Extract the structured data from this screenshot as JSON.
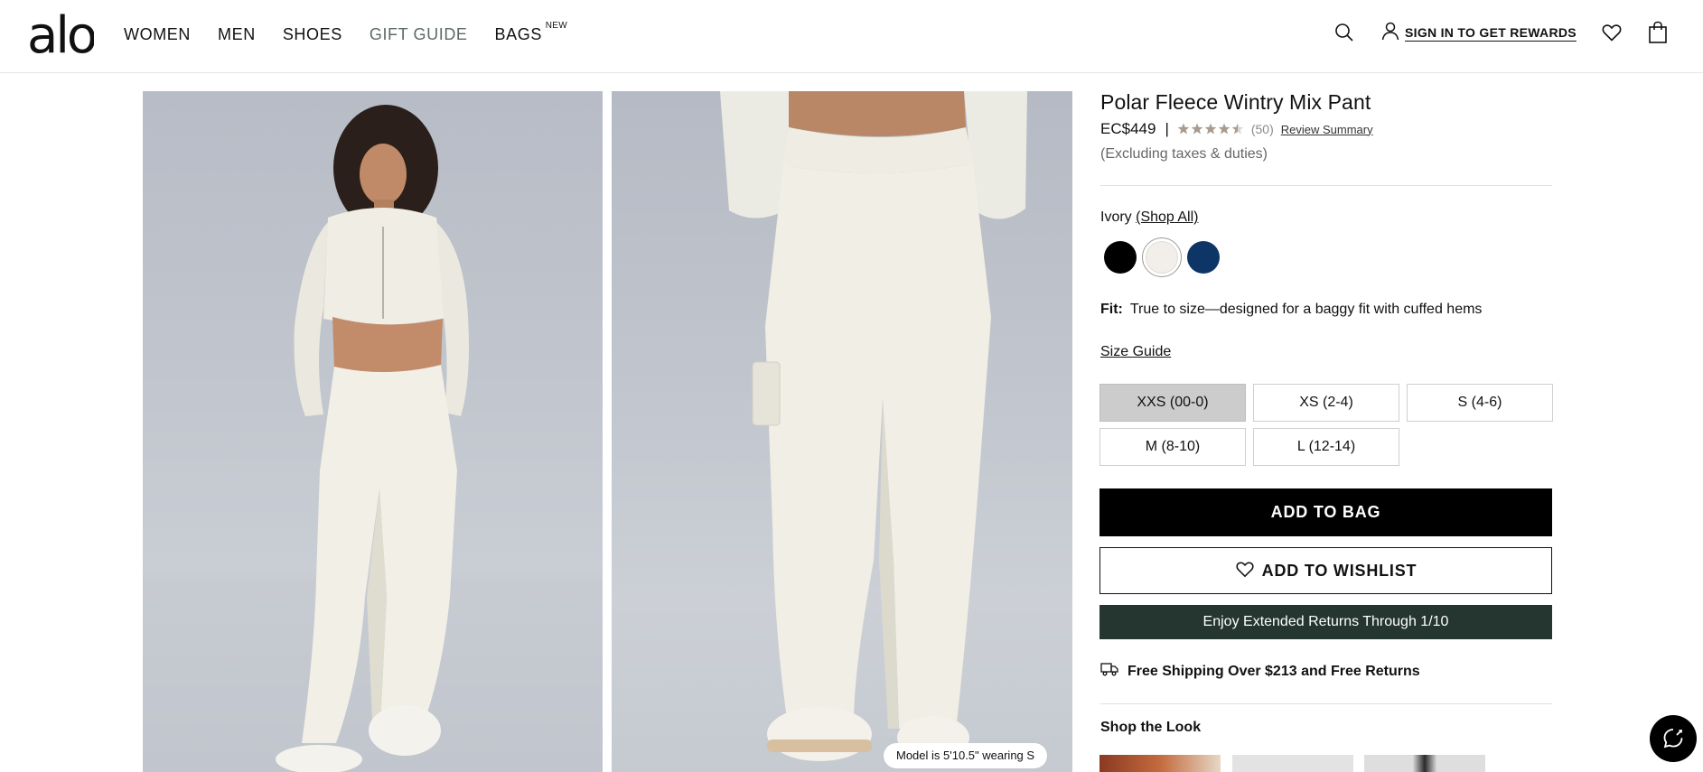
{
  "header": {
    "logo_text": "alo",
    "nav": [
      {
        "label": "WOMEN"
      },
      {
        "label": "MEN"
      },
      {
        "label": "SHOES"
      },
      {
        "label": "GIFT GUIDE"
      },
      {
        "label": "BAGS",
        "badge": "NEW"
      }
    ],
    "signin_label": "SIGN IN TO GET REWARDS",
    "icons": [
      "search-icon",
      "user-icon",
      "heart-icon",
      "shopping-bag-icon"
    ]
  },
  "gallery": {
    "model_info": "Model is 5'10.5\" wearing S"
  },
  "product": {
    "title": "Polar Fleece Wintry Mix Pant",
    "price": "EC$449",
    "price_separator": "|",
    "rating": 4.5,
    "review_count": "(50)",
    "review_summary_label": "Review Summary",
    "tax_note": "(Excluding taxes & duties)",
    "color_name": "Ivory",
    "shop_all_label": "(Shop All)",
    "swatches": [
      {
        "name": "black",
        "color": "#000000"
      },
      {
        "name": "ivory",
        "color": "#f2efea",
        "selected": true
      },
      {
        "name": "navy",
        "color": "#0d3566"
      }
    ],
    "fit_label": "Fit:",
    "fit_text": "True to size—designed for a baggy fit with cuffed hems",
    "size_guide_label": "Size Guide",
    "sizes": [
      {
        "label": "XXS (00-0)",
        "selected": true
      },
      {
        "label": "XS (2-4)"
      },
      {
        "label": "S (4-6)"
      },
      {
        "label": "M (8-10)"
      },
      {
        "label": "L (12-14)"
      }
    ],
    "add_to_bag_label": "ADD TO BAG",
    "add_to_wishlist_label": "ADD TO WISHLIST",
    "returns_banner": "Enjoy Extended Returns Through 1/10",
    "shipping_text": "Free Shipping Over $213 and Free Returns",
    "shop_the_look_label": "Shop the Look"
  },
  "colors": {
    "returns_banner_bg": "#253530",
    "selected_size_bg": "#cccccc",
    "star_color": "#a89c8e",
    "gift_guide_color": "#5d6a66"
  }
}
